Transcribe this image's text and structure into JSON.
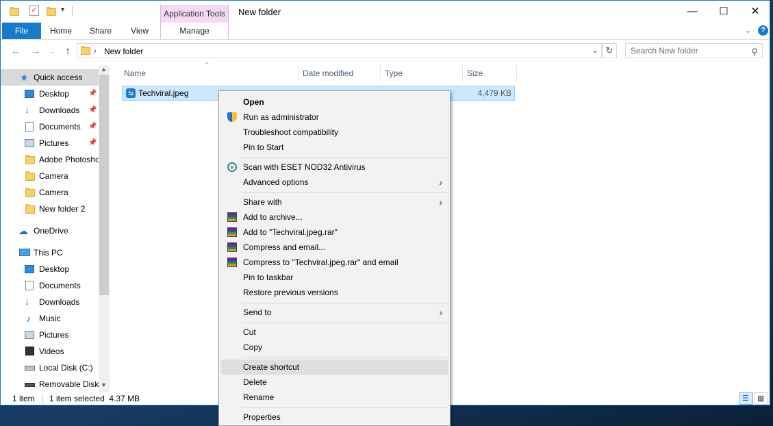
{
  "window": {
    "title": "New folder",
    "context_tab_group": "Application Tools",
    "minimize": "—",
    "maximize": "☐",
    "close": "✕"
  },
  "ribbon": {
    "tabs": [
      "File",
      "Home",
      "Share",
      "View",
      "Manage"
    ],
    "help": "?"
  },
  "address": {
    "path": "New folder",
    "search_placeholder": "Search New folder"
  },
  "nav": {
    "quick_access": "Quick access",
    "quick_items": [
      "Desktop",
      "Downloads",
      "Documents",
      "Pictures",
      "Adobe Photoshop",
      "Camera",
      "Camera",
      "New folder 2"
    ],
    "onedrive": "OneDrive",
    "this_pc": "This PC",
    "pc_items": [
      "Desktop",
      "Documents",
      "Downloads",
      "Music",
      "Pictures",
      "Videos",
      "Local Disk (C:)",
      "Removable Disk"
    ]
  },
  "columns": {
    "name": "Name",
    "date": "Date modified",
    "type": "Type",
    "size": "Size"
  },
  "file": {
    "name": "Techviral.jpeg",
    "size": "4,479 KB"
  },
  "status": {
    "count": "1 item",
    "selected": "1 item selected  4.37 MB"
  },
  "context_menu": {
    "open": "Open",
    "run_admin": "Run as administrator",
    "troubleshoot": "Troubleshoot compatibility",
    "pin_start": "Pin to Start",
    "scan": "Scan with ESET NOD32 Antivirus",
    "advanced": "Advanced options",
    "share_with": "Share with",
    "add_archive": "Add to archive...",
    "add_rar": "Add to \"Techviral.jpeg.rar\"",
    "compress_email": "Compress and email...",
    "compress_rar_email": "Compress to \"Techviral.jpeg.rar\" and email",
    "pin_taskbar": "Pin to taskbar",
    "restore": "Restore previous versions",
    "send_to": "Send to",
    "cut": "Cut",
    "copy": "Copy",
    "create_shortcut": "Create shortcut",
    "delete": "Delete",
    "rename": "Rename",
    "properties": "Properties"
  },
  "colors": {
    "accent": "#1979ca",
    "selection": "#cce8ff",
    "menu_bg": "#f2f2f2",
    "menu_hover": "#dedede"
  }
}
